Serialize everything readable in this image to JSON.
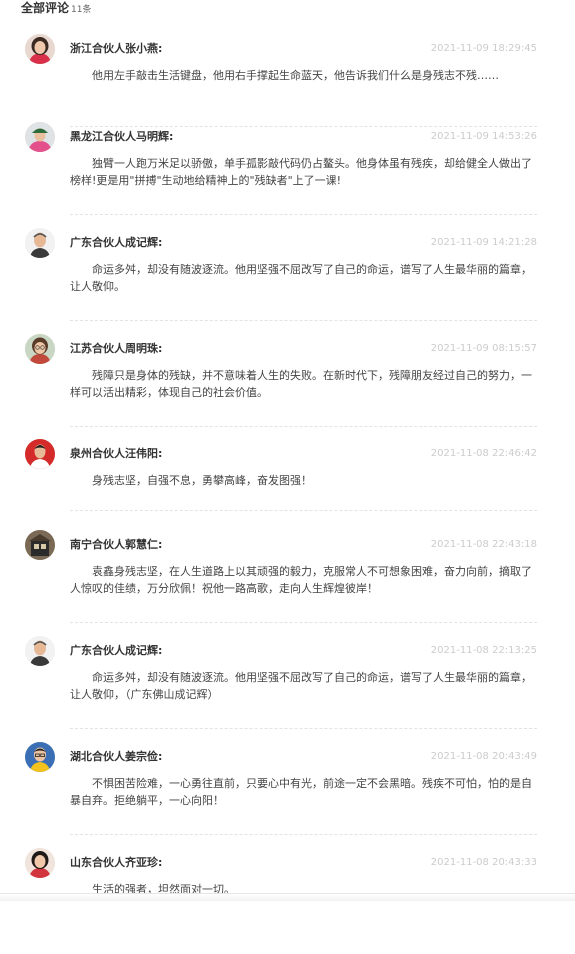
{
  "header": {
    "title": "全部评论",
    "count": "11条"
  },
  "comments": [
    {
      "author": "浙江合伙人张小燕:",
      "time": "2021-11-09 18:29:45",
      "content": "他用左手敲击生活键盘，他用右手撑起生命蓝天，他告诉我们什么是身残志不残……",
      "avatar": "avatar-woman-red"
    },
    {
      "author": "黑龙江合伙人马明辉:",
      "time": "2021-11-09 14:53:26",
      "content": "独臂一人跑万米足以骄傲，单手孤影敲代码仍占鳌头。他身体虽有残疾，却给健全人做出了榜样!更是用\"拼搏\"生动地给精神上的\"残缺者\"上了一课!",
      "avatar": "avatar-man-cap-pink"
    },
    {
      "author": "广东合伙人成记辉:",
      "time": "2021-11-09 14:21:28",
      "content": "命运多舛，却没有随波逐流。他用坚强不屈改写了自己的命运，谱写了人生最华丽的篇章，让人敬仰。",
      "avatar": "avatar-man-shaved"
    },
    {
      "author": "江苏合伙人周明珠:",
      "time": "2021-11-09 08:15:57",
      "content": "残障只是身体的残缺，并不意味着人生的失败。在新时代下，残障朋友经过自己的努力，一样可以活出精彩，体现自己的社会价值。",
      "avatar": "avatar-woman-glasses"
    },
    {
      "author": "泉州合伙人汪伟阳:",
      "time": "2021-11-08 22:46:42",
      "content": "身残志坚，自强不息，勇攀高峰，奋发图强！",
      "avatar": "avatar-man-red-bg"
    },
    {
      "author": "南宁合伙人郭慧仁:",
      "time": "2021-11-08 22:43:18",
      "content": "袁鑫身残志坚，在人生道路上以其顽强的毅力，克服常人不可想象困难，奋力向前，摘取了人惊叹的佳绩，万分欣佩！祝他一路高歌，走向人生辉煌彼岸！",
      "avatar": "avatar-building"
    },
    {
      "author": "广东合伙人成记辉:",
      "time": "2021-11-08 22:13:25",
      "content": "命运多舛，却没有随波逐流。他用坚强不屈改写了自己的命运，谱写了人生最华丽的篇章，让人敬仰，（广东佛山成记辉）",
      "avatar": "avatar-man-shaved"
    },
    {
      "author": "湖北合伙人姜宗俭:",
      "time": "2021-11-08 20:43:49",
      "content": "不惧困苦险难，一心勇往直前，只要心中有光，前途一定不会黑暗。残疾不可怕，怕的是自暴自弃。拒绝躺平，一心向阳！",
      "avatar": "avatar-man-glasses-blue"
    },
    {
      "author": "山东合伙人齐亚珍:",
      "time": "2021-11-08 20:43:33",
      "content": "生活的强者，坦然面对一切。",
      "avatar": "avatar-woman-dark-hair"
    }
  ]
}
